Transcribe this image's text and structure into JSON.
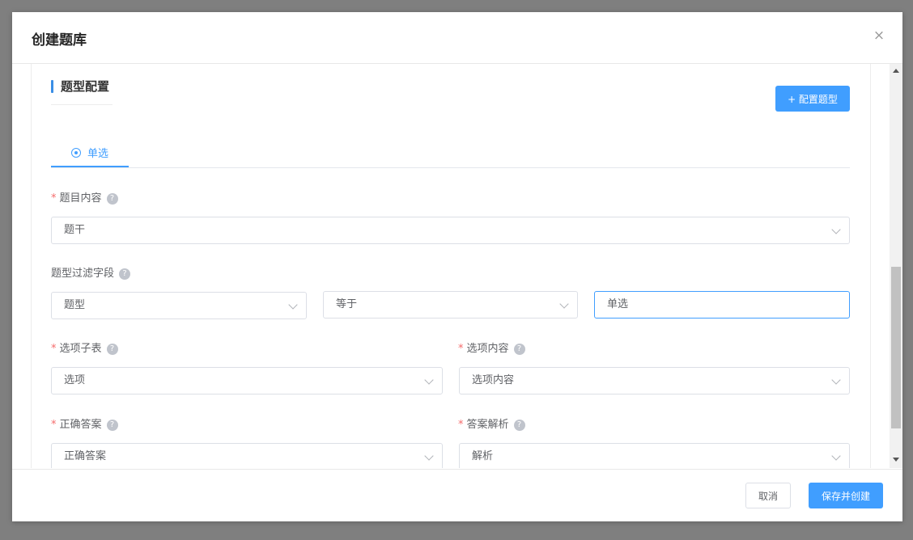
{
  "dialog": {
    "title": "创建题库",
    "close_glyph": "×"
  },
  "section": {
    "title": "题型配置",
    "config_button": "+ 配置题型"
  },
  "tabs": [
    {
      "label": "单选",
      "icon": "radio-circle-icon",
      "active": true
    }
  ],
  "form": {
    "content": {
      "label": "题目内容",
      "required": "*",
      "value": "题干"
    },
    "filter": {
      "label": "题型过滤字段",
      "field_value": "题型",
      "operator_value": "等于",
      "input_value": "单选"
    },
    "option_table": {
      "label": "选项子表",
      "required": "*",
      "value": "选项"
    },
    "option_content": {
      "label": "选项内容",
      "required": "*",
      "value": "选项内容"
    },
    "answer": {
      "label": "正确答案",
      "required": "*",
      "value": "正确答案"
    },
    "analysis": {
      "label": "答案解析",
      "required": "*",
      "value": "解析"
    },
    "help_glyph": "?"
  },
  "footer": {
    "cancel": "取消",
    "save": "保存并创建"
  },
  "colors": {
    "primary": "#409eff",
    "required": "#f56c6c"
  }
}
